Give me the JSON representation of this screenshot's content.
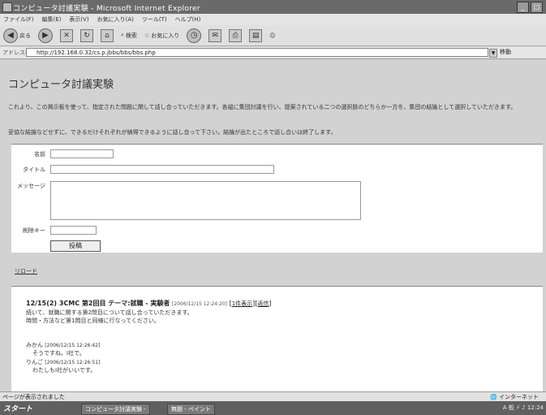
{
  "window": {
    "title": "コンピュータ討議実験 - Microsoft Internet Explorer"
  },
  "menu": [
    "ファイル(F)",
    "編集(E)",
    "表示(V)",
    "お気に入り(A)",
    "ツール(T)",
    "ヘルプ(H)"
  ],
  "toolbar": {
    "back": "戻る",
    "search": "検索",
    "favorites": "お気に入り"
  },
  "address": {
    "label": "アドレス(D)",
    "url": "http://192.168.0.32/cs.p.jbbs/bbs/bbs.php",
    "go": "移動"
  },
  "page": {
    "title": "コンピュータ討議実験",
    "desc1": "これより、この掲示板を使って、指定された問題に関して話し合っていただきます。各組に集団討議を行い、提案されている二つの選択肢のどちらか一方を、集団の結論として選択していただきます。",
    "desc2": "妥協な結論などせずに、できるだけそれぞれが納得できるように話し合って下さい。結論が出たところで話し合いは終了します。"
  },
  "form": {
    "name_label": "名前",
    "title_label": "タイトル",
    "message_label": "メッセージ",
    "key_label": "削除キー",
    "submit_label": "投稿"
  },
  "reload_link": "リロード",
  "post": {
    "heading": "12/15(2) 3CMC 第2回目 テーマ:就職 - 実験者",
    "timestamp": "[2006/12/15 12:24:20]",
    "link1": "1件表示",
    "link2": "返信",
    "line1": "続いて、就職に関する第2問目について話し合っていただきます。",
    "line2": "時間・方法など第1問目と同様に行なってください。",
    "replies": [
      {
        "name": "みかん",
        "time": "[2006/12/15 12:26:42]",
        "text": "そうですね。I社で。"
      },
      {
        "name": "りんご",
        "time": "[2006/12/15 12:26:51]",
        "text": "わたしもI社がいいです。"
      }
    ]
  },
  "status": {
    "left": "ページが表示されました",
    "right": "インターネット"
  },
  "taskbar": {
    "start": "スタート",
    "task1": "コンピュータ討議実験 -",
    "task2": "無題 - ペイント",
    "tray": "A 般 ⚡ ♪ 12:24"
  }
}
